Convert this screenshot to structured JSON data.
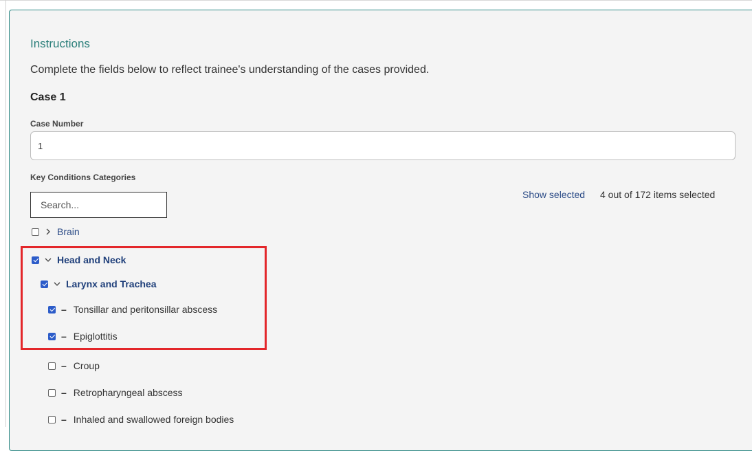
{
  "instructions": {
    "heading": "Instructions",
    "description": "Complete the fields below to reflect trainee's understanding of the cases provided."
  },
  "case": {
    "title": "Case 1",
    "number_label": "Case Number",
    "number_value": "1"
  },
  "key_conditions": {
    "label": "Key Conditions Categories",
    "search_placeholder": "Search...",
    "show_selected": "Show selected",
    "count_text": "4 out of 172 items selected"
  },
  "tree": {
    "brain": "Brain",
    "head_neck": "Head and Neck",
    "larynx": "Larynx and Trachea",
    "leaves": [
      {
        "label": "Tonsillar and peritonsillar abscess",
        "checked": true
      },
      {
        "label": "Epiglottitis",
        "checked": true
      },
      {
        "label": "Croup",
        "checked": false
      },
      {
        "label": "Retropharyngeal abscess",
        "checked": false
      },
      {
        "label": "Inhaled and swallowed foreign bodies",
        "checked": false
      }
    ]
  },
  "colors": {
    "accent_teal": "#2b7f7a",
    "link_blue": "#2a4a86",
    "checkbox_blue": "#2c5cc9",
    "highlight_red": "#e3262a"
  }
}
